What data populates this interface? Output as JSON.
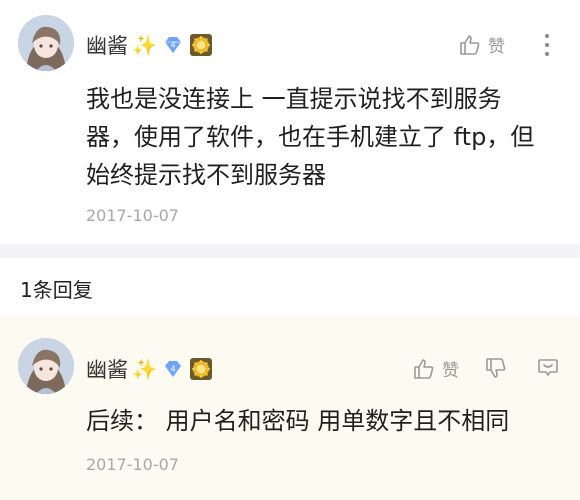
{
  "comment": {
    "username": "幽酱",
    "sparkle": "✨",
    "level": "4",
    "like_label": "赞",
    "text_lines": [
      "我也是没连接上 一直提示说找不到服务",
      "器，使用了软件，也在手机建立了 ftp，但",
      "始终提示找不到服务器"
    ],
    "date": "2017-10-07"
  },
  "reply_section": {
    "count_label": "1条回复"
  },
  "reply": {
    "username": "幽酱",
    "sparkle": "✨",
    "level": "4",
    "like_label": "赞",
    "text": "后续：  用户名和密码 用单数字且不相同",
    "date": "2017-10-07"
  },
  "colors": {
    "level_badge": "#6ea4ff",
    "medal": "#f2b51d",
    "reply_background": "#fcfaf1",
    "divider": "#f4f4f6"
  }
}
